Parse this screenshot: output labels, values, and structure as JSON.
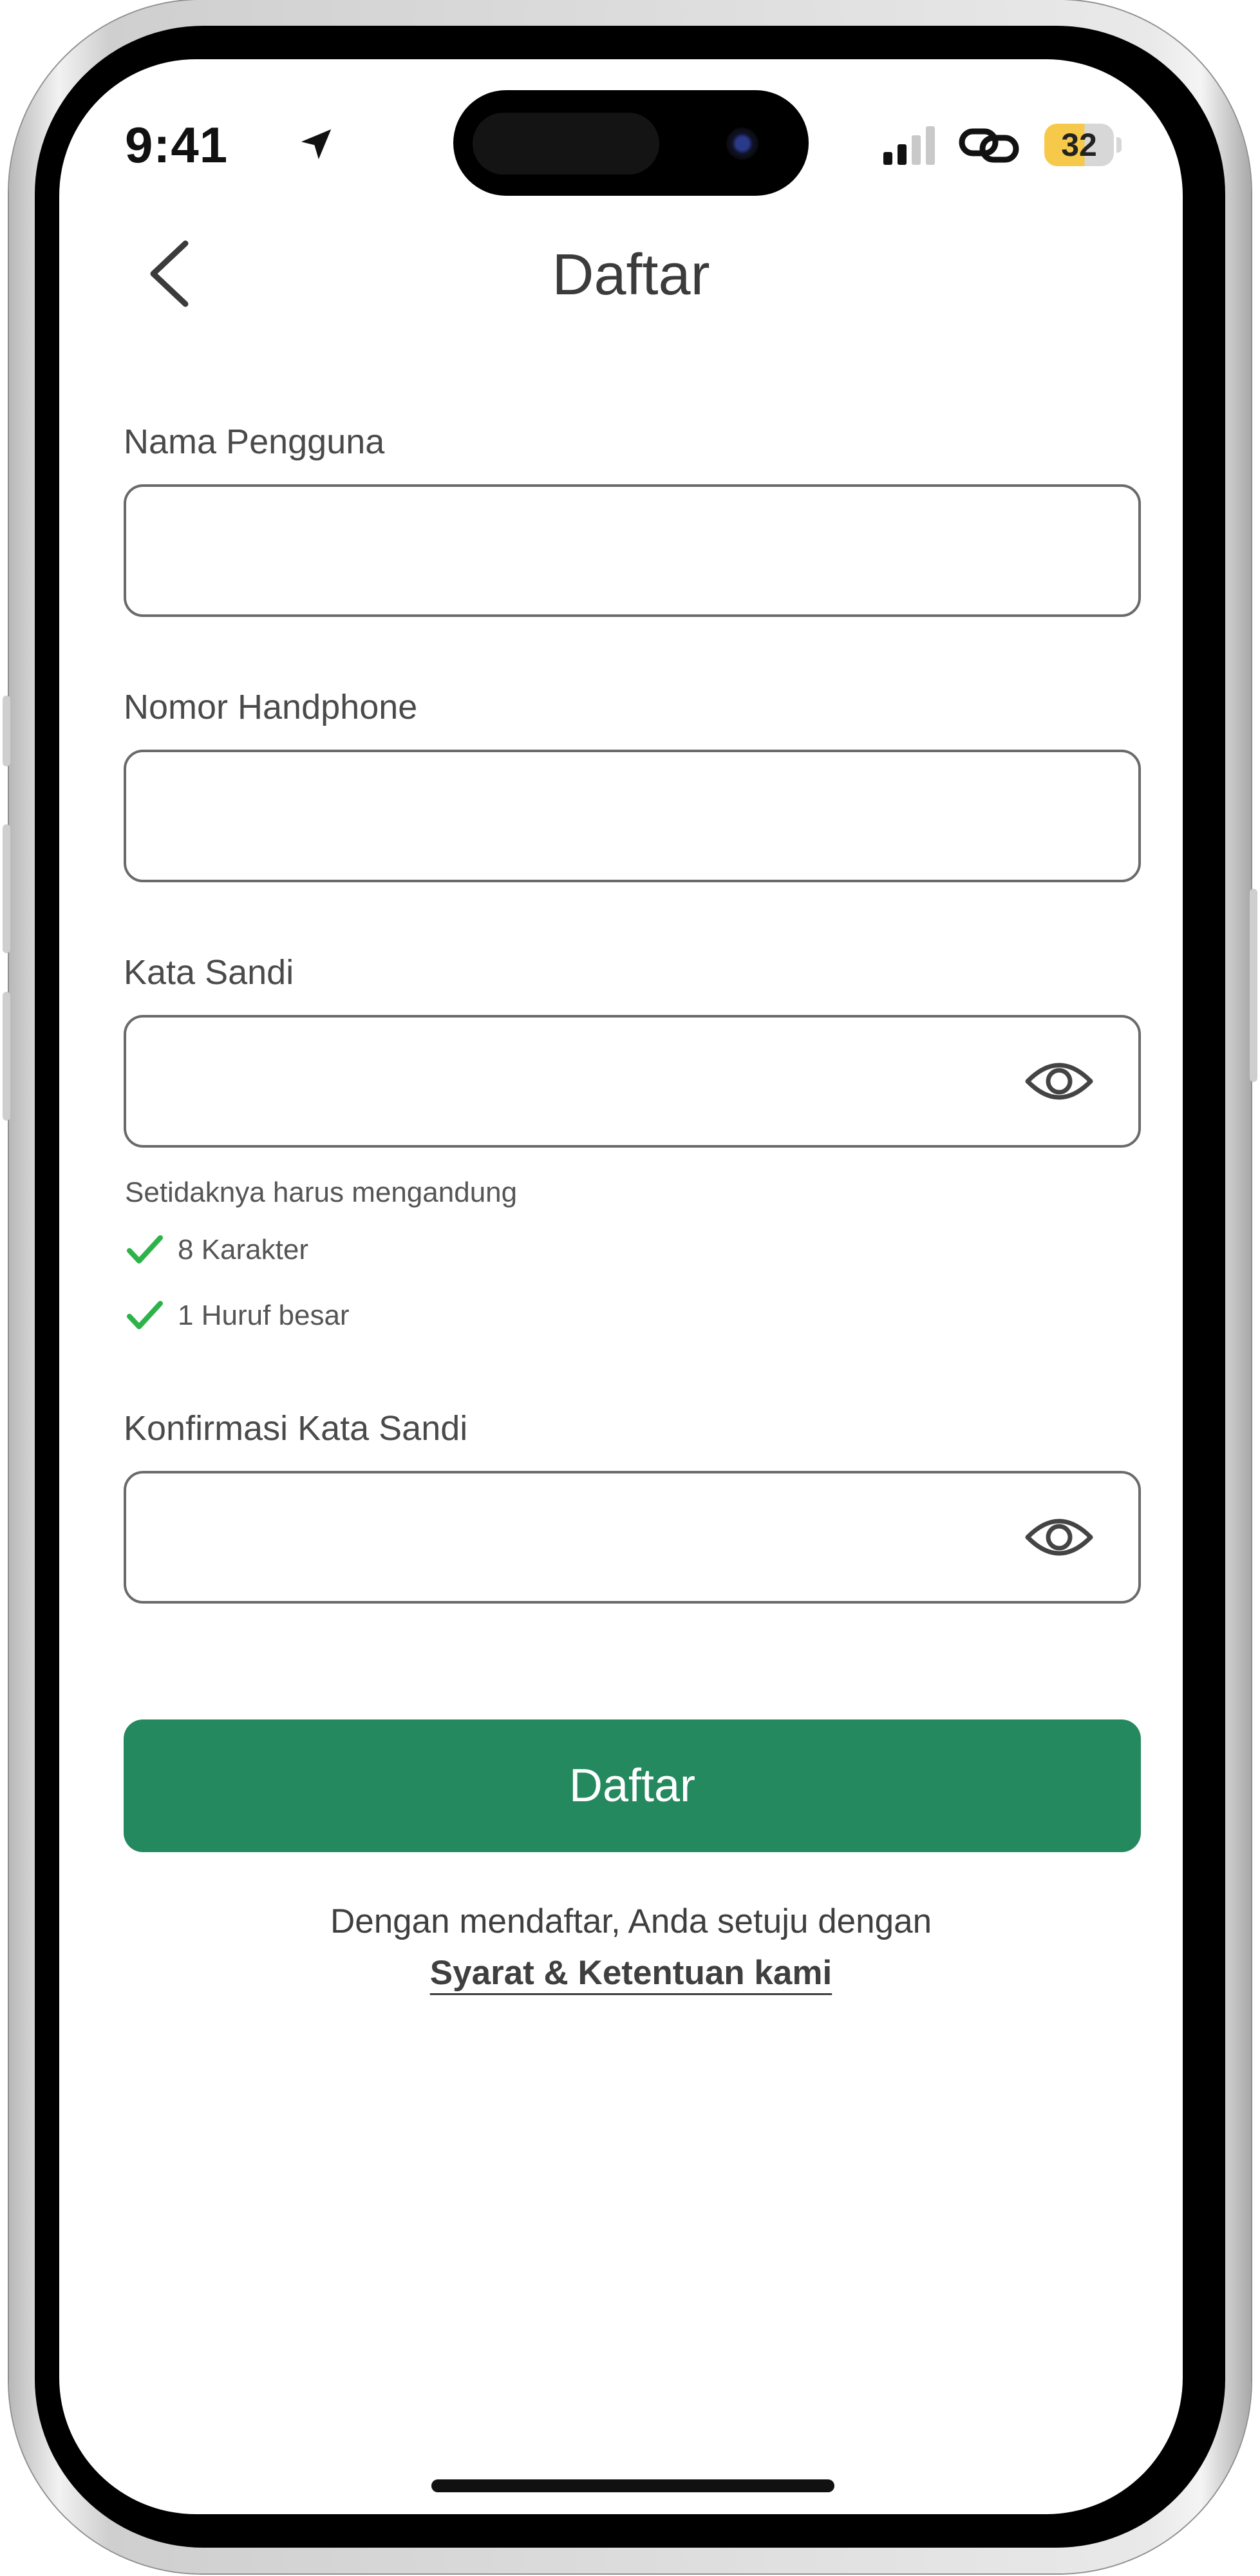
{
  "status_bar": {
    "time": "9:41",
    "battery_level": "32",
    "icons": [
      "location-arrow-icon",
      "cellular-signal-icon",
      "link-icon",
      "battery-icon"
    ]
  },
  "header": {
    "title": "Daftar",
    "back_icon": "chevron-left-icon"
  },
  "form": {
    "username": {
      "label": "Nama Pengguna",
      "value": ""
    },
    "phone": {
      "label": "Nomor Handphone",
      "value": ""
    },
    "password": {
      "label": "Kata Sandi",
      "value": "",
      "toggle_icon": "eye-icon"
    },
    "password_rules": {
      "intro": "Setidaknya harus mengandung",
      "items": [
        {
          "label": "8 Karakter",
          "met": true
        },
        {
          "label": "1 Huruf besar",
          "met": true
        }
      ]
    },
    "confirm_password": {
      "label": "Konfirmasi Kata Sandi",
      "value": "",
      "toggle_icon": "eye-icon"
    }
  },
  "submit": {
    "label": "Daftar"
  },
  "terms": {
    "text": "Dengan mendaftar, Anda setuju dengan",
    "link": "Syarat & Ketentuan kami"
  },
  "colors": {
    "primary_button": "#25895f",
    "check_green": "#2db34a",
    "battery_yellow": "#f6c94a",
    "text_dark": "#3b3b3b"
  }
}
